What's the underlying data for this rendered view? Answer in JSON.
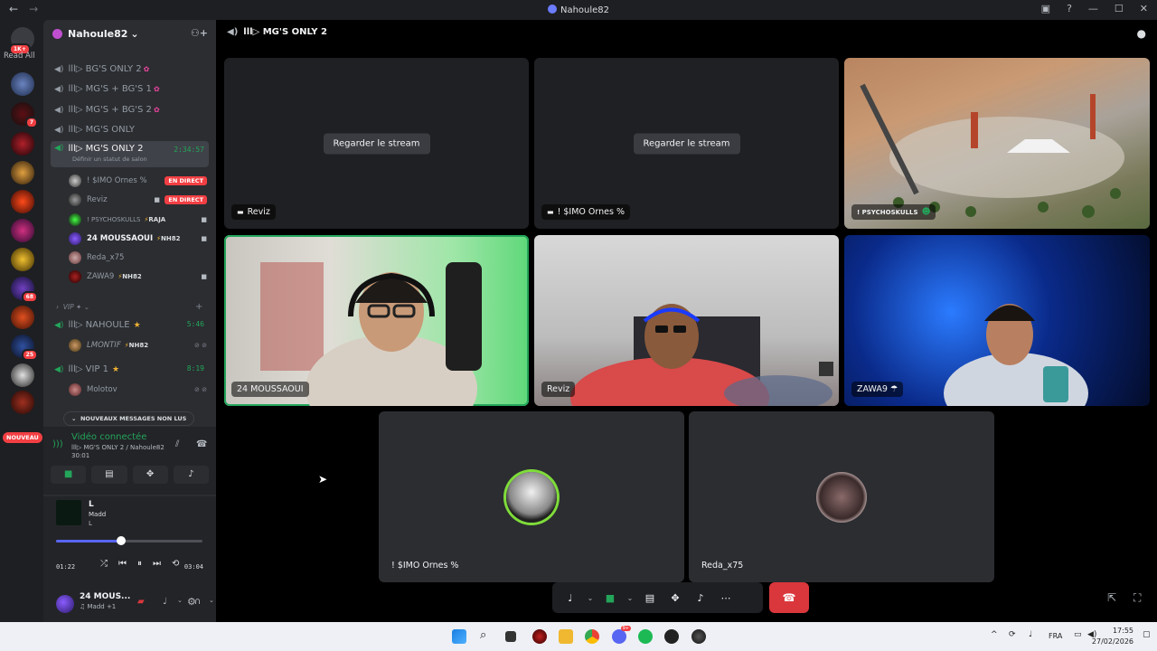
{
  "window": {
    "title": "Nahoule82",
    "nav_back": "←",
    "nav_fwd": "→",
    "icons": [
      "inbox-icon",
      "help-icon",
      "minimize-icon",
      "maximize-icon",
      "close-icon"
    ]
  },
  "rail": {
    "home_badge": "1K+",
    "read_all": "Read All",
    "badges": {
      "s2": "7",
      "s9": "68",
      "s11": "25"
    },
    "nouveau": "NOUVEAU"
  },
  "guild": {
    "name": "Nahoule82",
    "chevron": "⌄",
    "add_member_icon": "add-member-icon"
  },
  "channels": [
    {
      "name": "lll▷ BG'S ONLY 2",
      "emoji": "✿"
    },
    {
      "name": "lll▷ MG'S + BG'S 1",
      "emoji": "✿"
    },
    {
      "name": "lll▷ MG'S + BG'S 2",
      "emoji": "✿"
    },
    {
      "name": "lll▷ MG'S ONLY",
      "emoji": ""
    },
    {
      "name": "lll▷ MG'S ONLY 2",
      "timer": "2:34:57",
      "status": "Définir un statut de salon"
    }
  ],
  "voice_users": [
    {
      "name": "! $IMO Ornes %",
      "live": "EN DIRECT"
    },
    {
      "name": "Reviz",
      "live": "EN DIRECT"
    },
    {
      "name": "! PSYCHOSKULLS",
      "tag_prefix": "⚡",
      "tag": "RAJA"
    },
    {
      "name": "24 MOUSSAOUI",
      "tag_prefix": "⚡",
      "tag": "NH82"
    },
    {
      "name": "Reda_x75"
    },
    {
      "name": "ZAWA9",
      "tag_prefix": "⚡",
      "tag": "NH82"
    }
  ],
  "vip_category": "VIP ✦ ⌄",
  "vip_channels": [
    {
      "name": "lll▷ NAHOULE",
      "timer": "5:46",
      "user": "LMONTIF",
      "tag_prefix": "⚡",
      "tag": "NH82"
    },
    {
      "name": "lll▷ VIP 1",
      "timer": "8:19",
      "user": "Molotov"
    }
  ],
  "new_messages": "NOUVEAUX MESSAGES NON LUS",
  "voice_status": {
    "state": "Vidéo connectée",
    "path": "lll▷ MG'S ONLY 2 / Nahoule82",
    "elapsed": "30:01"
  },
  "music": {
    "title": "L",
    "artist": "Madd",
    "album": "L",
    "current": "01:22",
    "total": "03:04",
    "progress": 0.4457
  },
  "user": {
    "name": "24 MOUS...",
    "sub": "♫ Madd +1"
  },
  "stage": {
    "channel": "lll▷ MG'S ONLY 2",
    "watch_label": "Regarder le stream",
    "tiles": [
      {
        "name": "Reviz",
        "kind": "stream"
      },
      {
        "name": "! $IMO Ornes %",
        "kind": "stream"
      },
      {
        "name": "! PSYCHOSKULLS",
        "kind": "screen"
      },
      {
        "name": "24 MOUSSAOUI",
        "kind": "camera"
      },
      {
        "name": "Reviz",
        "kind": "camera"
      },
      {
        "name": "ZAWA9 ☂",
        "kind": "camera"
      },
      {
        "name": "! $IMO Ornes %",
        "kind": "avatar"
      },
      {
        "name": "Reda_x75",
        "kind": "avatar"
      }
    ]
  },
  "taskbar": {
    "lang": "FRA",
    "time": "17:55",
    "date": "27/02/2026",
    "discord_badge": "9+"
  },
  "colors": {
    "accent": "#5865f2",
    "green": "#23a55a",
    "red": "#da373c",
    "live": "#f23f43"
  }
}
